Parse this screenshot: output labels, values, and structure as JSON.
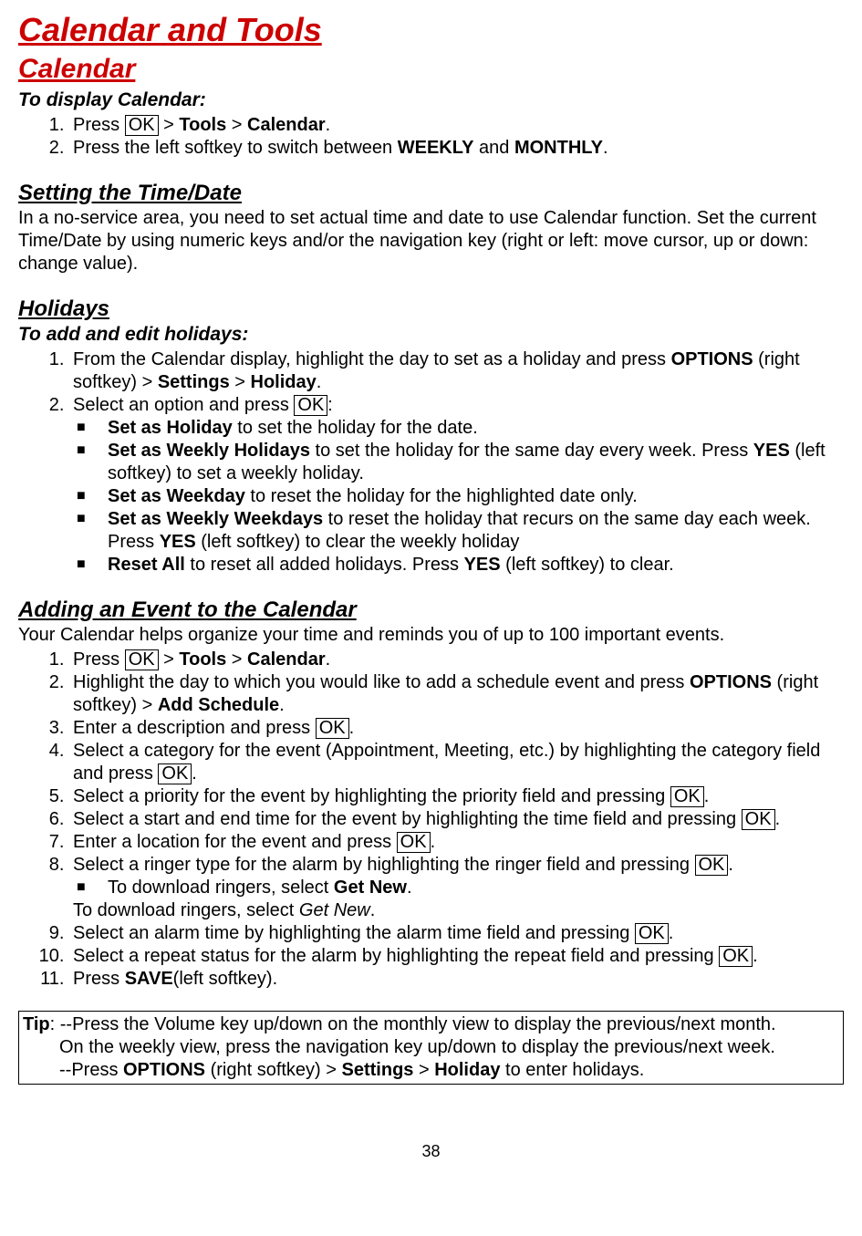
{
  "title": "Calendar and Tools",
  "sec1": {
    "heading": "Calendar",
    "sub": "To display Calendar:",
    "step1a": "Press ",
    "ok": "OK",
    "step1b": " > ",
    "tools": "Tools",
    "step1c": " > ",
    "cal": "Calendar",
    "step1d": ".",
    "step2a": "Press the left softkey to switch between ",
    "weekly": "WEEKLY",
    "step2b": " and ",
    "monthly": "MONTHLY",
    "step2c": "."
  },
  "sec2": {
    "heading": "Setting the Time/Date",
    "text": "In a no-service area, you need to set actual time and date to use Calendar function. Set the current Time/Date by using numeric keys and/or the navigation key (right or left: move cursor, up or down: change value)."
  },
  "sec3": {
    "heading": "Holidays",
    "sub": "To add and edit holidays:",
    "s1a": "From the Calendar display, highlight the day to set as a holiday and press ",
    "options": "OPTIONS",
    "s1b": " (right softkey) > ",
    "settings": "Settings",
    "s1c": " > ",
    "holiday": "Holiday",
    "s1d": ".",
    "s2a": "Select an option and press ",
    "s2b": ":",
    "b1": {
      "t": "Set as Holiday",
      "r": " to set the holiday for the date."
    },
    "b2": {
      "t": "Set as Weekly Holidays",
      "r": " to set the holiday for the same day every week. Press ",
      "yes": "YES",
      "r2": " (left softkey) to set a weekly holiday."
    },
    "b3": {
      "t": "Set as Weekday",
      "r": " to reset the holiday for the highlighted date only."
    },
    "b4": {
      "t": "Set as Weekly Weekdays",
      "r": " to reset the holiday that recurs on the same day each week. Press ",
      "yes": "YES",
      "r2": " (left softkey) to clear the weekly holiday"
    },
    "b5": {
      "t": "Reset All",
      "r": " to reset all added holidays. Press ",
      "yes": "YES",
      "r2": " (left softkey) to clear."
    }
  },
  "sec4": {
    "heading": "Adding an Event to the Calendar",
    "intro": "Your Calendar helps organize your time and reminds you of up to 100 important events.",
    "s1a": "Press ",
    "s1b": " > ",
    "tools": "Tools",
    "s1c": " > ",
    "cal": "Calendar",
    "s1d": ".",
    "s2a": "Highlight the day to which you would like to add a schedule event and press ",
    "options": "OPTIONS",
    "s2b": " (right softkey) > ",
    "addSched": "Add Schedule",
    "s2c": ".",
    "s3a": "Enter a description and press ",
    "s3b": ".",
    "s4a": "Select a category for the event (Appointment, Meeting, etc.) by highlighting the category field and press ",
    "s4b": ".",
    "s5a": "Select a priority for the event by highlighting the priority field and pressing ",
    "s5b": ".",
    "s6a": "Select a start and end time for the event by highlighting the time field and pressing ",
    "s6b": ".",
    "s7a": "Enter a location for the event and press ",
    "s7b": ".",
    "s8a": "Select a ringer type for the alarm by highlighting the ringer field and pressing ",
    "s8b": ".",
    "s8bul_a": "To download ringers, select ",
    "getnew": "Get New",
    "s8bul_b": ".",
    "s8plain_a": "To download ringers, select ",
    "s8plain_i": "Get New",
    "s8plain_b": ".",
    "s9a": "Select an alarm time by highlighting the alarm time field and pressing ",
    "s9b": ".",
    "s10a": "Select a repeat status for the alarm by highlighting the repeat field and pressing ",
    "s10b": ".",
    "s11a": "Press ",
    "save": "SAVE",
    "s11b": "(left softkey)."
  },
  "tip": {
    "label": "Tip",
    "l1": ": --Press the Volume key up/down on the monthly view to display the previous/next month.",
    "l2": "On the weekly view, press the navigation key up/down to display the previous/next week.",
    "l3a": "--Press ",
    "options": "OPTIONS",
    "l3b": " (right softkey) > ",
    "settings": "Settings",
    "l3c": " > ",
    "holiday": "Holiday",
    "l3d": " to enter holidays."
  },
  "page": "38"
}
